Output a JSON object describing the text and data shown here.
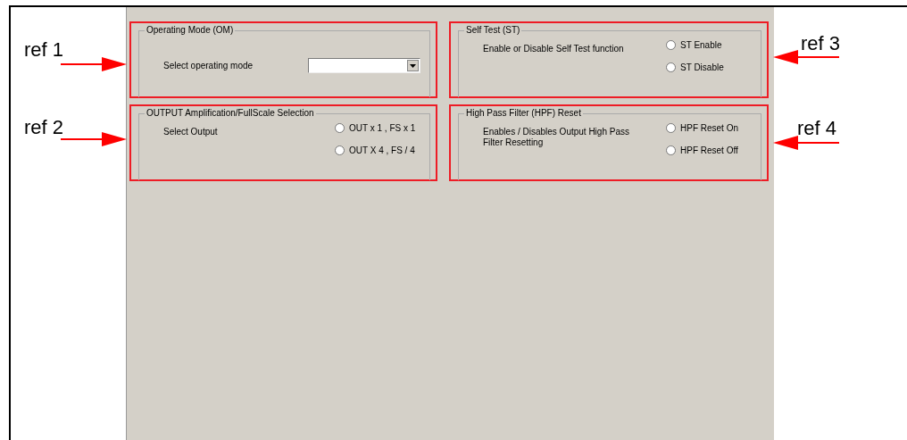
{
  "groups": [
    {
      "title": "Operating Mode (OM)",
      "kind": "dropdown",
      "description": "Select operating mode"
    },
    {
      "title": "Self Test (ST)",
      "kind": "radio",
      "description": "Enable or Disable Self Test function",
      "options": [
        {
          "label": "ST Enable",
          "selected": false
        },
        {
          "label": "ST Disable",
          "selected": false
        }
      ]
    },
    {
      "title": "OUTPUT Amplification/FullScale Selection",
      "kind": "radio",
      "description": "Select Output",
      "options": [
        {
          "label": "OUT x 1 , FS x 1",
          "selected": false
        },
        {
          "label": "OUT X 4 , FS / 4",
          "selected": false
        }
      ]
    },
    {
      "title": "High Pass Filter (HPF) Reset",
      "kind": "radio",
      "description": "Enables / Disables Output High Pass Filter Resetting",
      "options": [
        {
          "label": "HPF Reset On",
          "selected": false
        },
        {
          "label": "HPF Reset Off",
          "selected": false
        }
      ]
    }
  ],
  "annotations": [
    {
      "label": "ref 1",
      "kind": "left"
    },
    {
      "label": "ref 2",
      "kind": "left"
    },
    {
      "label": "ref 3",
      "kind": "right"
    },
    {
      "label": "ref 4",
      "kind": "right"
    }
  ]
}
